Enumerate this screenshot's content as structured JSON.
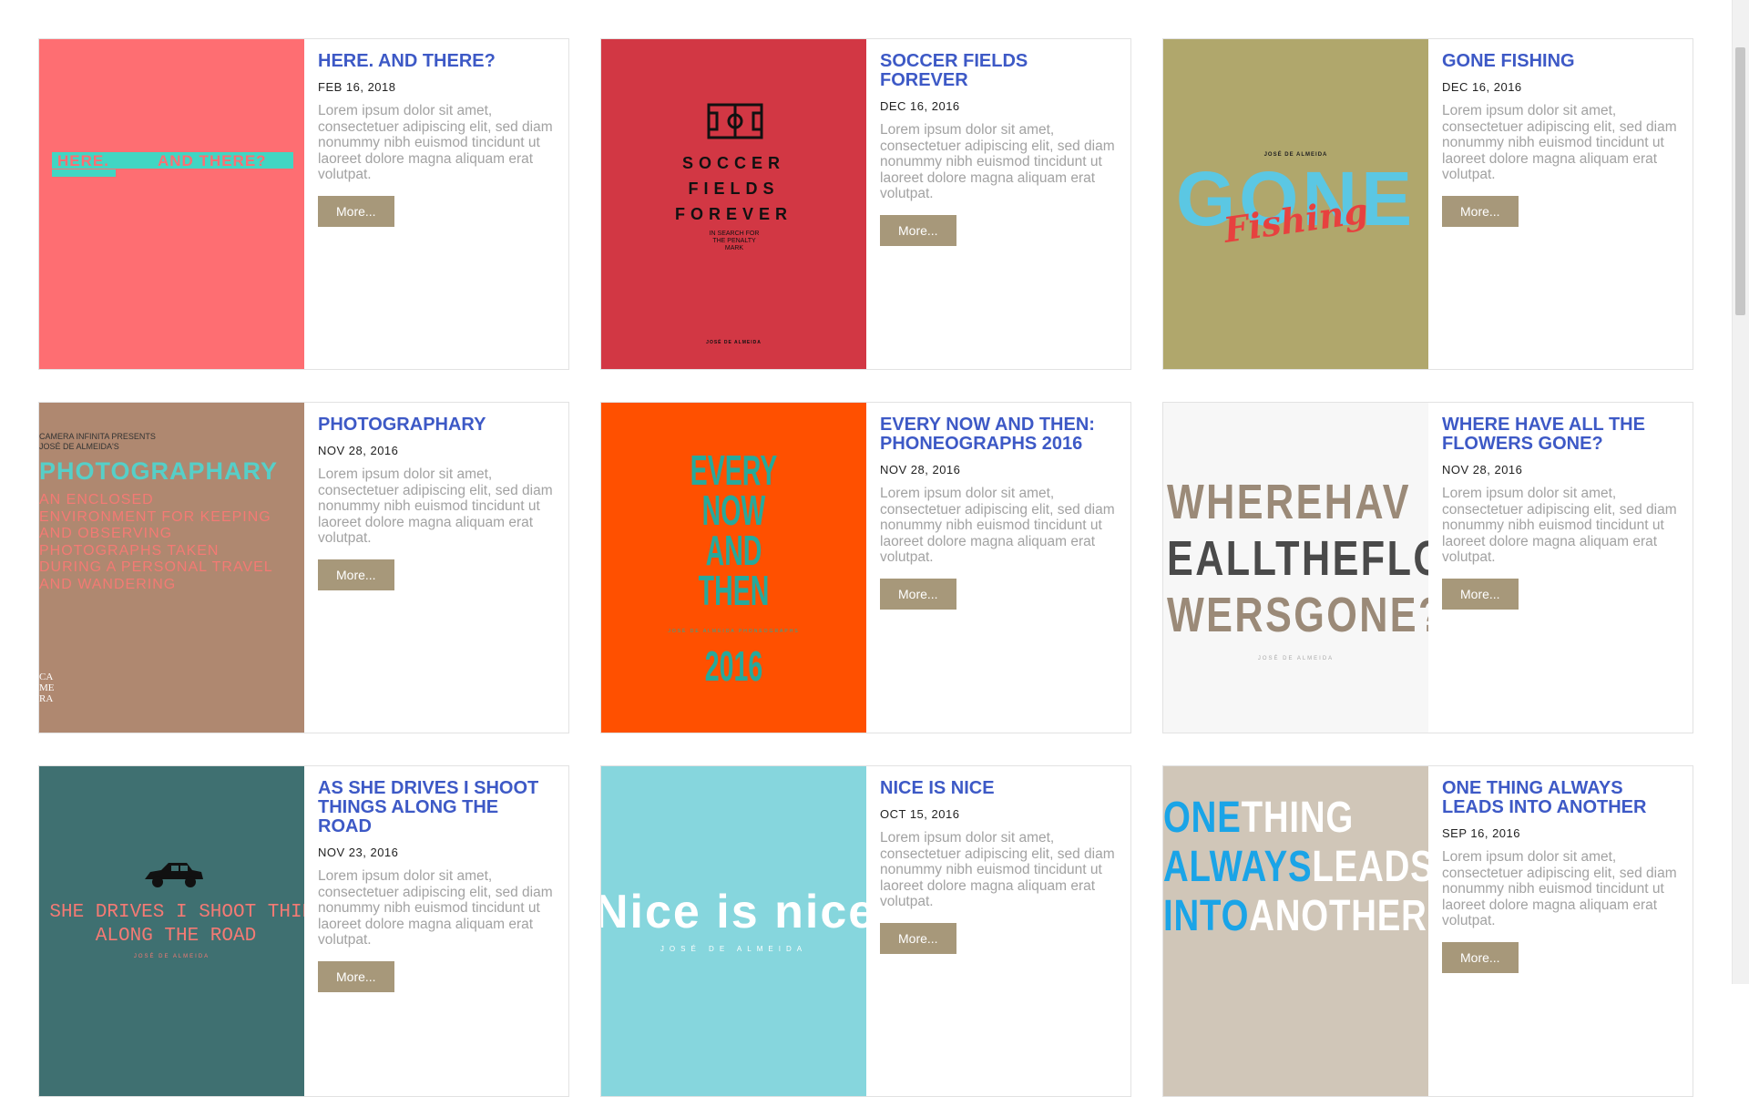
{
  "cards": [
    {
      "title": "HERE. AND THERE?",
      "date": "FEB 16, 2018",
      "excerpt": "Lorem ipsum dolor sit amet, consectetuer adipiscing elit, sed diam nonummy nibh euismod tincidunt ut laoreet dolore magna aliquam erat volutpat.",
      "more": "More...",
      "cover_color": "#fe6e72",
      "cover": {
        "line1": "HERE.",
        "line2": "AND THERE?"
      }
    },
    {
      "title": "SOCCER FIELDS FOREVER",
      "date": "DEC 16, 2016",
      "excerpt": "Lorem ipsum dolor sit amet, consectetuer adipiscing elit, sed diam nonummy nibh euismod tincidunt ut laoreet dolore magna aliquam erat volutpat.",
      "more": "More...",
      "cover_color": "#d23744",
      "cover": {
        "line1": "SOCCER",
        "line2": "FIELDS",
        "line3": "FOREVER",
        "sub": "IN SEARCH FOR THE PENALTY MARK",
        "author": "JOSÉ DE ALMEIDA"
      }
    },
    {
      "title": "GONE FISHING",
      "date": "DEC 16, 2016",
      "excerpt": "Lorem ipsum dolor sit amet, consectetuer adipiscing elit, sed diam nonummy nibh euismod tincidunt ut laoreet dolore magna aliquam erat volutpat.",
      "more": "More...",
      "cover_color": "#b0a76c",
      "cover": {
        "author": "JOSÉ DE ALMEIDA",
        "line1": "GONE",
        "line2": "Fishing"
      }
    },
    {
      "title": "PHOTOGRAPHARY",
      "date": "NOV 28, 2016",
      "excerpt": "Lorem ipsum dolor sit amet, consectetuer adipiscing elit, sed diam nonummy nibh euismod tincidunt ut laoreet dolore magna aliquam erat volutpat.",
      "more": "More...",
      "cover_color": "#af8870",
      "cover": {
        "presents": "CAMERA INFINITA PRESENTS",
        "author": "JOSÉ DE ALMEIDA'S",
        "line1": "PHOTOGRAPHARY",
        "body": "AN ENCLOSED ENVIRONMENT FOR KEEPING AND OBSERVING PHOTOGRAPHS TAKEN DURING A PERSONAL TRAVEL AND WANDERING"
      }
    },
    {
      "title": "EVERY NOW AND THEN: PHONEOGRAPHS 2016",
      "date": "NOV 28, 2016",
      "excerpt": "Lorem ipsum dolor sit amet, consectetuer adipiscing elit, sed diam nonummy nibh euismod tincidunt ut laoreet dolore magna aliquam erat volutpat.",
      "more": "More...",
      "cover_color": "#ff5000",
      "cover": {
        "line1": "EVERY",
        "line2": "NOW",
        "line3": "AND",
        "line4": "THEN",
        "sub": "JOSÉ DE ALMEIDA PHONEOGRAPHS",
        "line5": "2016"
      }
    },
    {
      "title": "WHERE HAVE ALL THE FLOWERS GONE?",
      "date": "NOV 28, 2016",
      "excerpt": "Lorem ipsum dolor sit amet, consectetuer adipiscing elit, sed diam nonummy nibh euismod tincidunt ut laoreet dolore magna aliquam erat volutpat.",
      "more": "More...",
      "cover_color": "#f7f7f7",
      "cover": {
        "line1": "WHEREHAV",
        "line2": "EALLTHEFLO",
        "line3": "WERSGONE?",
        "author": "JOSÉ DE ALMEIDA"
      }
    },
    {
      "title": "AS SHE DRIVES I SHOOT THINGS ALONG THE ROAD",
      "date": "NOV 23, 2016",
      "excerpt": "Lorem ipsum dolor sit amet, consectetuer adipiscing elit, sed diam nonummy nibh euismod tincidunt ut laoreet dolore magna aliquam erat volutpat.",
      "more": "More...",
      "cover_color": "#3f7071",
      "cover": {
        "line1": "AS SHE DRIVES I SHOOT THINGS",
        "line2": "ALONG THE ROAD",
        "author": "JOSÉ DE ALMEIDA"
      }
    },
    {
      "title": "NICE IS NICE",
      "date": "OCT 15, 2016",
      "excerpt": "Lorem ipsum dolor sit amet, consectetuer adipiscing elit, sed diam nonummy nibh euismod tincidunt ut laoreet dolore magna aliquam erat volutpat.",
      "more": "More...",
      "cover_color": "#86d6dd",
      "cover": {
        "line1": "Nice is nice",
        "author": "JOSÉ DE ALMEIDA"
      }
    },
    {
      "title": "ONE THING ALWAYS LEADS INTO ANOTHER",
      "date": "SEP 16, 2016",
      "excerpt": "Lorem ipsum dolor sit amet, consectetuer adipiscing elit, sed diam nonummy nibh euismod tincidunt ut laoreet dolore magna aliquam erat volutpat.",
      "more": "More...",
      "cover_color": "#d0c6b8",
      "cover": {
        "a1": "ONE",
        "b1": "THING",
        "a2": "ALWAYS",
        "b2": "LEADS",
        "a3": "INTO",
        "b3": "ANOTHER"
      }
    }
  ]
}
